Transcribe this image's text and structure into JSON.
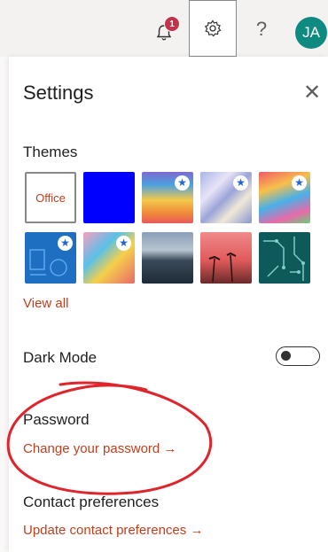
{
  "topbar": {
    "notification_count": "1",
    "help_glyph": "?",
    "avatar_initials": "JA"
  },
  "settings": {
    "title": "Settings",
    "close_glyph": "✕",
    "themes": {
      "heading": "Themes",
      "office_label": "Office",
      "view_all": "View all"
    },
    "dark_mode": {
      "label": "Dark Mode",
      "enabled": false
    },
    "password": {
      "heading": "Password",
      "link": "Change your password →"
    },
    "contact": {
      "heading": "Contact preferences",
      "link": "Update contact preferences →"
    }
  },
  "colors": {
    "accent_link": "#c43e1c",
    "avatar_bg": "#0f8a80",
    "badge_bg": "#c4314b",
    "annotation": "#e0242c"
  }
}
